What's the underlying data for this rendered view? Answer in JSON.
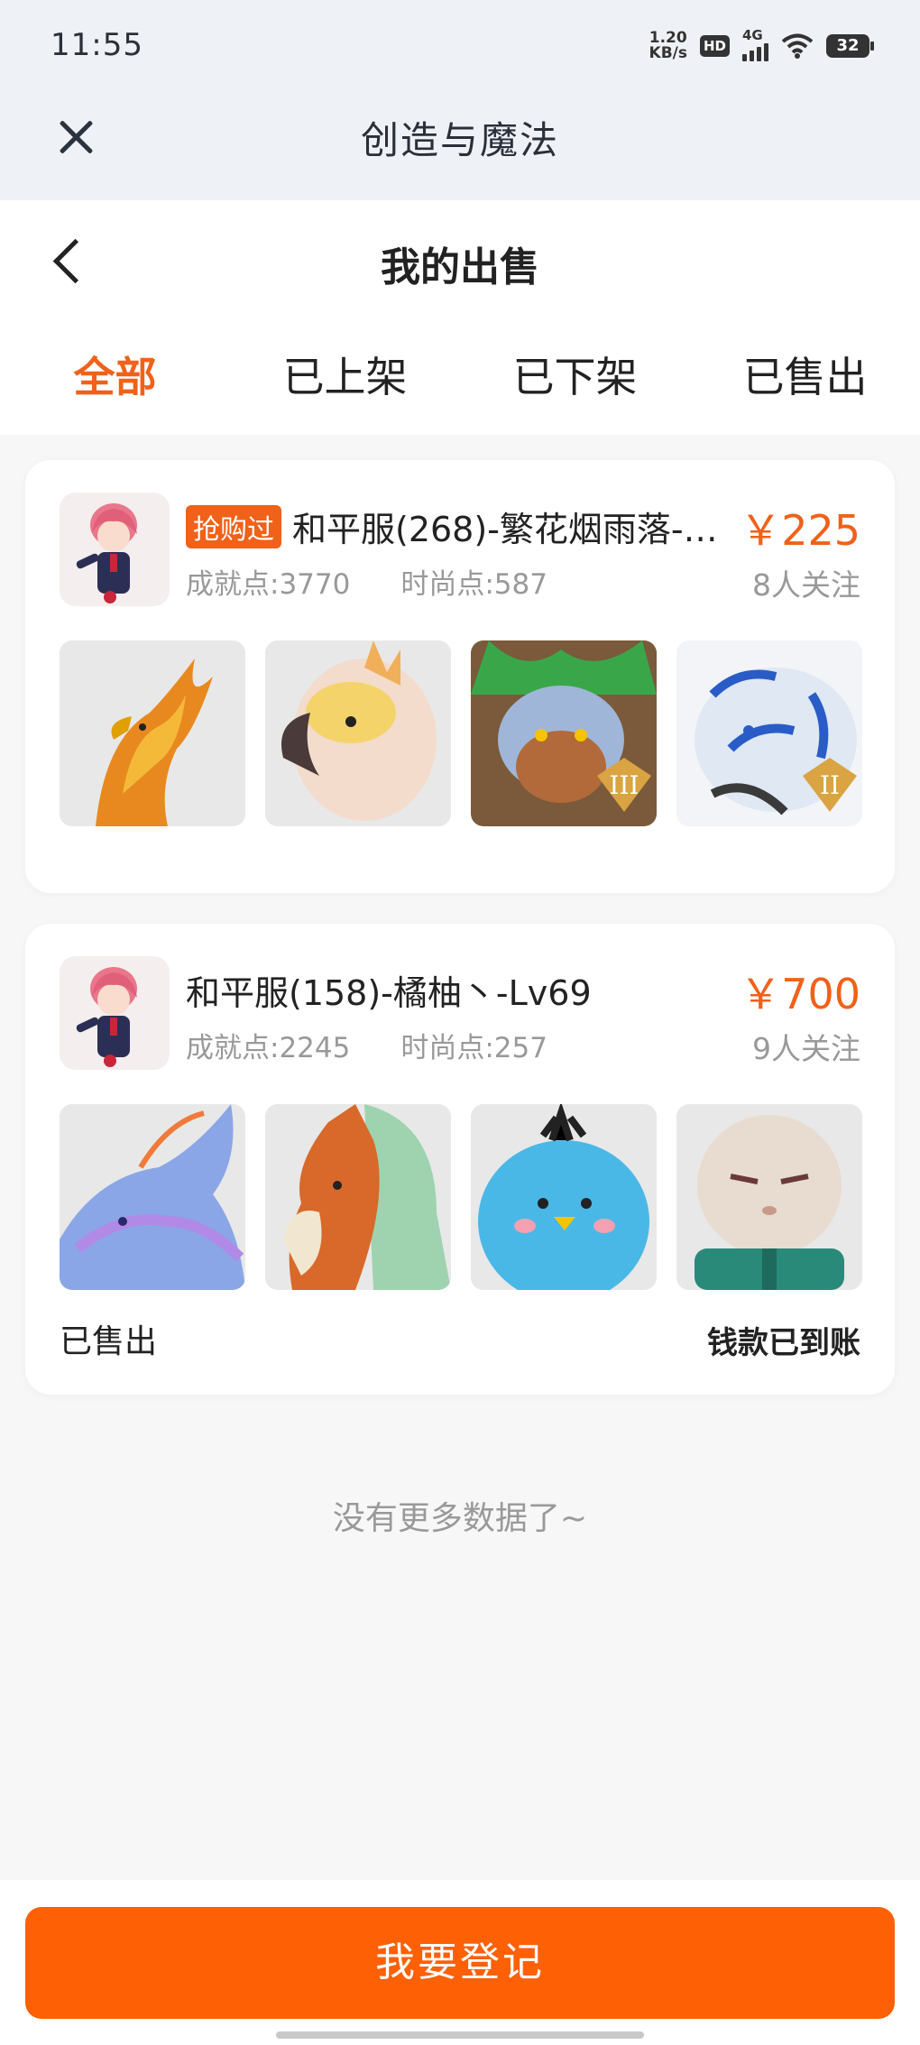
{
  "status": {
    "time": "11:55",
    "speed_top": "1.20",
    "speed_bottom": "KB/s",
    "hd": "HD",
    "network": "4G",
    "battery": "32"
  },
  "appbar": {
    "title": "创造与魔法"
  },
  "page": {
    "title": "我的出售"
  },
  "tabs": [
    {
      "label": "全部",
      "active": true
    },
    {
      "label": "已上架",
      "active": false
    },
    {
      "label": "已下架",
      "active": false
    },
    {
      "label": "已售出",
      "active": false
    }
  ],
  "listings": [
    {
      "tag": "抢购过",
      "name": "和平服(268)-繁花烟雨落-…",
      "achievement": "成就点:3770",
      "fashion": "时尚点:587",
      "price": "￥225",
      "follow": "8人关注",
      "pets": [
        "phoenix-orange",
        "parrot-yellow",
        "armored-lion",
        "blue-tiger"
      ],
      "status_left": "",
      "status_right": ""
    },
    {
      "tag": "",
      "name": "和平服(158)-橘柚丶-Lv69",
      "achievement": "成就点:2245",
      "fashion": "时尚点:257",
      "price": "￥700",
      "follow": "9人关注",
      "pets": [
        "blue-dragon",
        "orange-horse",
        "blue-bird",
        "bald-figure"
      ],
      "status_left": "已售出",
      "status_right": "钱款已到账"
    }
  ],
  "footer": {
    "no_more": "没有更多数据了~",
    "register_button": "我要登记"
  },
  "colors": {
    "accent": "#f0611a",
    "button": "#fe6006",
    "header_bg": "#eef2f7"
  }
}
